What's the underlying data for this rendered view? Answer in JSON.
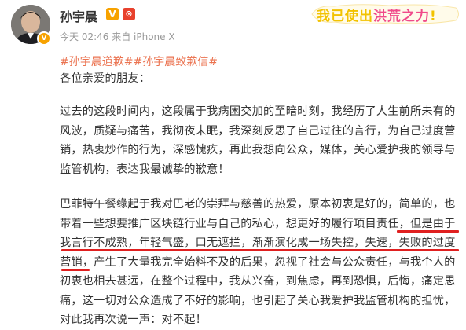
{
  "post": {
    "author": "孙宇晨",
    "verified_badge": "V",
    "red_badge": "⊙",
    "meta": "今天 02:46 来自 iPhone X",
    "banner": {
      "part1": "我已使出",
      "part2": "洪荒之力",
      "part3": "!",
      "colors": {
        "main": "#f2c200",
        "accent": "#f04a8a"
      }
    },
    "hashtags": [
      "#孙宇晨道歉#",
      "#孙宇晨致歉信#"
    ],
    "greeting": "各位亲爱的朋友：",
    "paragraph1": "过去的这段时间内，这段属于我病困交加的至暗时刻，我经历了人生前所未有的风波，质疑与痛苦，我彻夜未眠，我深刻反思了自己过往的言行，为自己过度营销，热衷炒作的行为，深感愧疚，再此我想向公众，媒体，关心爱护我的领导与监管机构，表达我最诚挚的歉意！",
    "paragraph2": "巴菲特午餐缘起于我对巴老的崇拜与慈善的热爱，原本初衷是好的，简单的，也带着一些想要推广区块链行业与自己的私心，想更好的履行项目责任，但是由于我言行不成熟，年轻气盛，口无遮拦，渐渐演化成一场失控，失速，失败的过度营销，产生了大量我完全始料不及的后果，忽视了社会与公众责任，与我个人的初衷也相去甚远，在整个过程中，我从兴奋，到焦虑，再到恐惧，后悔，痛定思痛，这一切对公众造成了不好的影响，也引起了关心我爱护我监管机构的担忧，对此我再次说一声：对不起！"
  },
  "colors": {
    "link": "#eb7350",
    "text": "#333333",
    "meta": "#999999",
    "underline": "#e02020"
  }
}
